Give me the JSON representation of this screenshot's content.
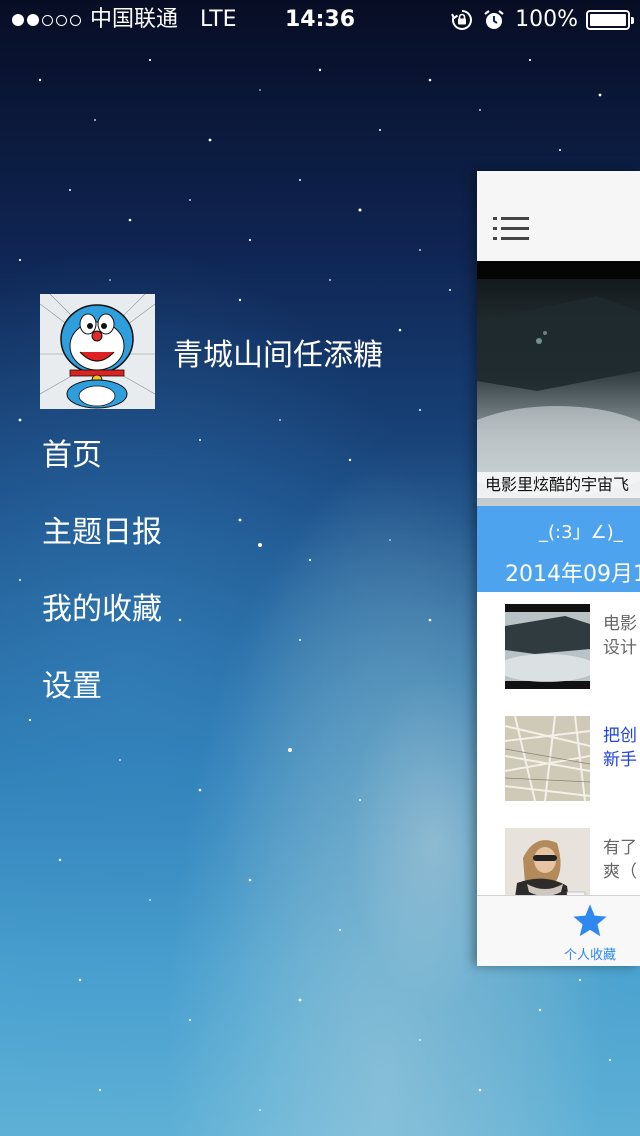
{
  "status_bar": {
    "carrier": "中国联通",
    "network": "LTE",
    "time": "14:36",
    "battery": "100%",
    "signal_bars_filled": 2,
    "signal_bars_total": 5
  },
  "profile": {
    "username": "青城山间任添糖",
    "avatar_icon": "doraemon-avatar"
  },
  "menu": {
    "items": [
      {
        "label": "首页"
      },
      {
        "label": "主题日报"
      },
      {
        "label": "我的收藏"
      },
      {
        "label": "设置"
      }
    ]
  },
  "panel": {
    "hero_caption": "电影里炫酷的宇宙飞",
    "banner_text": "_(:3」∠)_",
    "date": "2014年09月1",
    "news": [
      {
        "title": "电影\n设计"
      },
      {
        "title": "把创\n新手"
      },
      {
        "title": "有了\n爽（"
      }
    ],
    "tab_label": "个人收藏"
  },
  "colors": {
    "accent": "#4ea3ee",
    "link": "#1f42e0",
    "tab_active": "#2e88f0"
  }
}
